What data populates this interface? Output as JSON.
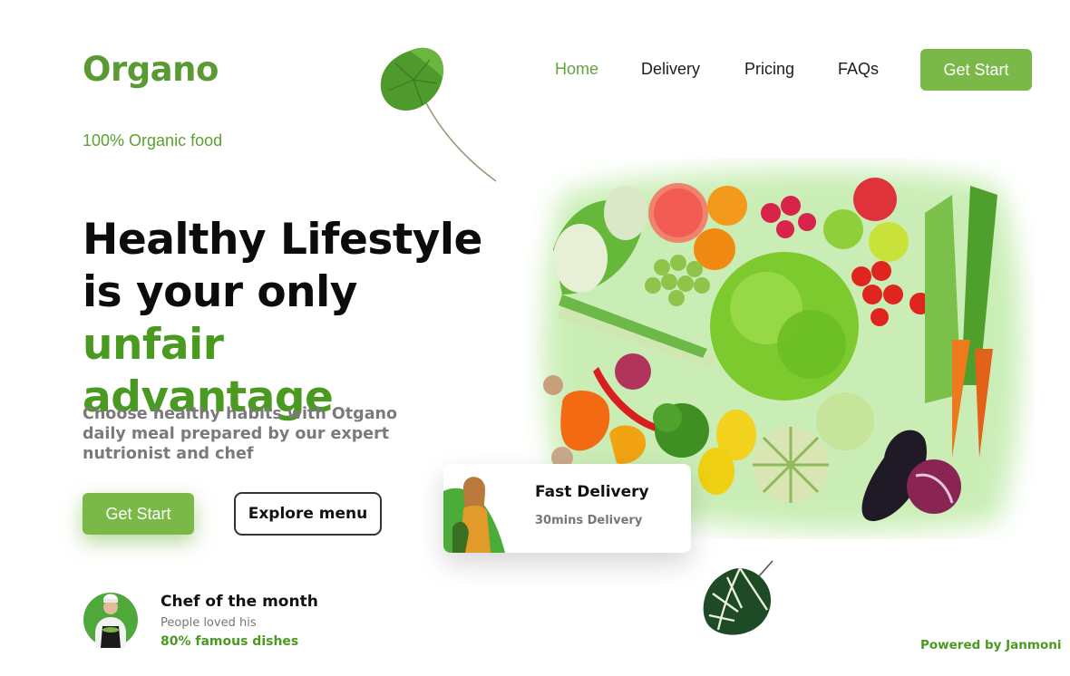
{
  "brand": {
    "name": "Organo",
    "tagline": "100% Organic food"
  },
  "nav": {
    "items": [
      {
        "label": "Home",
        "active": true
      },
      {
        "label": "Delivery",
        "active": false
      },
      {
        "label": "Pricing",
        "active": false
      },
      {
        "label": "FAQs",
        "active": false
      }
    ],
    "cta": "Get Start"
  },
  "hero": {
    "line1": "Healthy Lifestyle",
    "line2": "is your only ",
    "highlight1": "unfair",
    "highlight2": "advantage",
    "description": "Choose healthy habits with Otgano daily meal prepared by our expert nutrionist and chef",
    "primary_button": "Get Start",
    "secondary_button": "Explore menu"
  },
  "chef": {
    "title": "Chef of the month",
    "subtitle": "People loved his",
    "highlight": "80% famous dishes"
  },
  "delivery_card": {
    "title": "Fast Delivery",
    "subtitle": "30mins Delivery"
  },
  "footer": {
    "credit": "Powered by Janmoni"
  },
  "colors": {
    "brand_green": "#5a9a34",
    "accent_green": "#4a9a21",
    "button_green": "#7ab848",
    "text_dark": "#111111",
    "text_muted": "#777777"
  },
  "icons": [
    "leaf-icon",
    "vegetables-image",
    "chef-avatar",
    "delivery-person-image",
    "monstera-leaf-icon"
  ]
}
